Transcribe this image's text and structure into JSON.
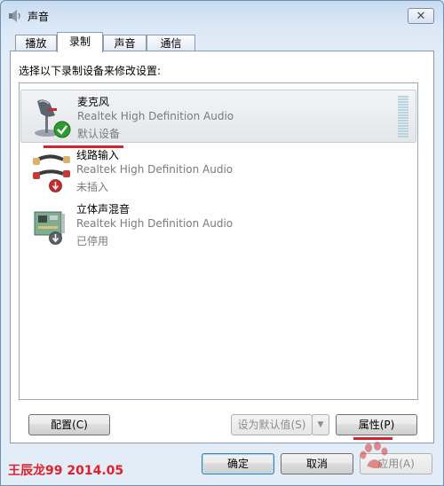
{
  "window": {
    "title": "声音",
    "close_label": "✕"
  },
  "tabs": [
    {
      "label": "播放",
      "active": false
    },
    {
      "label": "录制",
      "active": true
    },
    {
      "label": "声音",
      "active": false
    },
    {
      "label": "通信",
      "active": false
    }
  ],
  "instruction": "选择以下录制设备来修改设置:",
  "devices": [
    {
      "name": "麦克风",
      "driver": "Realtek High Definition Audio",
      "status": "默认设备",
      "icon": "microphone-icon",
      "badge": "default-checkmark-icon",
      "selected": true
    },
    {
      "name": "线路输入",
      "driver": "Realtek High Definition Audio",
      "status": "未插入",
      "icon": "line-in-cable-icon",
      "badge": "unplugged-arrow-icon",
      "selected": false
    },
    {
      "name": "立体声混音",
      "driver": "Realtek High Definition Audio",
      "status": "已停用",
      "icon": "sound-card-icon",
      "badge": "disabled-arrow-icon",
      "selected": false
    }
  ],
  "buttons": {
    "configure": "配置(C)",
    "set_default": "设为默认值(S)",
    "properties": "属性(P)",
    "ok": "确定",
    "cancel": "取消",
    "apply": "应用(A)"
  },
  "watermark": "王辰龙99 2014.05",
  "colors": {
    "annotation_red": "#d4232e",
    "default_badge_green": "#2e9b2e",
    "status_gray": "#7a7a7a"
  }
}
